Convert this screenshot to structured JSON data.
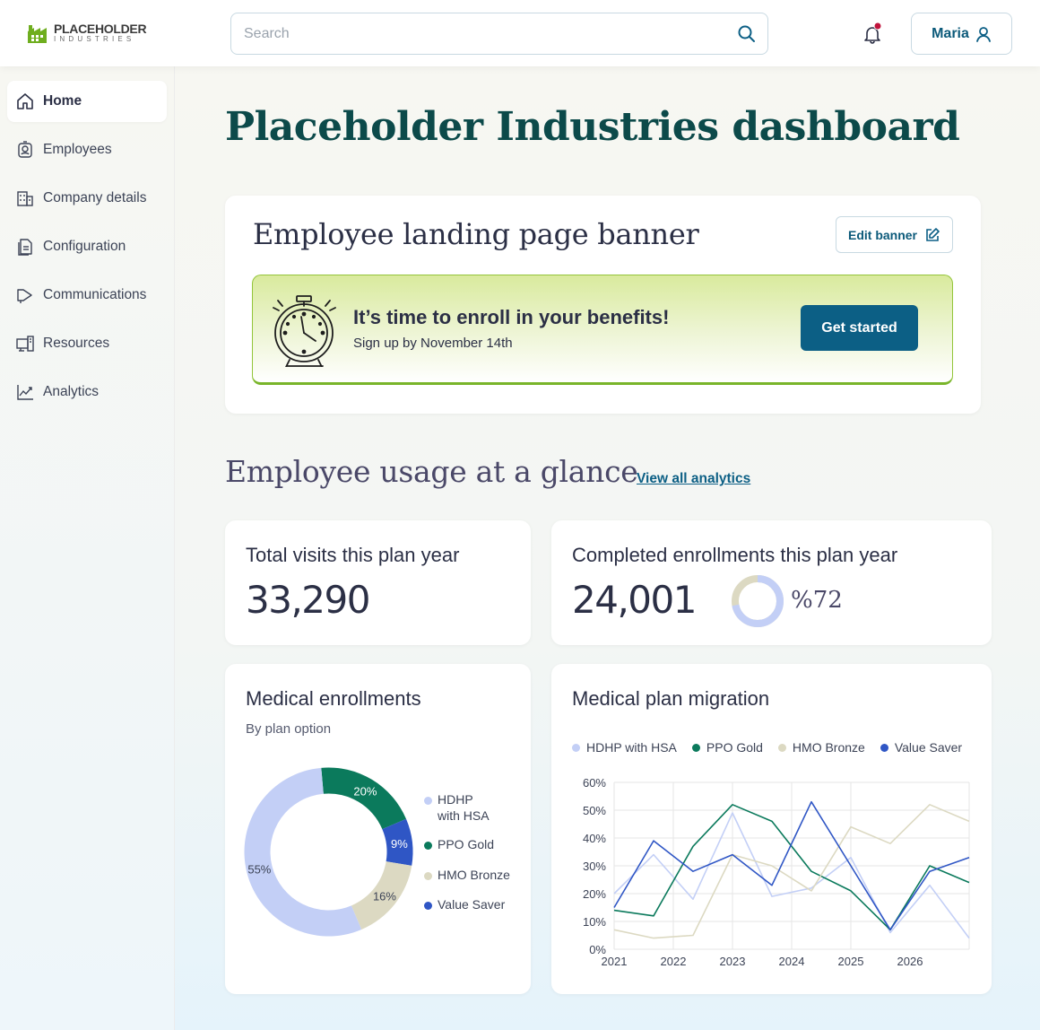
{
  "brand": {
    "name": "PLACEHOLDER",
    "sub": "INDUSTRIES"
  },
  "search": {
    "placeholder": "Search"
  },
  "user": {
    "name": "Maria"
  },
  "sidebar": {
    "items": [
      {
        "label": "Home",
        "icon": "home-icon"
      },
      {
        "label": "Employees",
        "icon": "badge-icon"
      },
      {
        "label": "Company details",
        "icon": "building-icon"
      },
      {
        "label": "Configuration",
        "icon": "document-icon"
      },
      {
        "label": "Communications",
        "icon": "megaphone-icon"
      },
      {
        "label": "Resources",
        "icon": "resources-icon"
      },
      {
        "label": "Analytics",
        "icon": "chart-line-icon"
      }
    ]
  },
  "page": {
    "title": "Placeholder Industries dashboard"
  },
  "banner": {
    "heading": "Employee landing page banner",
    "edit_label": "Edit banner",
    "promo_title": "It’s time to enroll in your benefits!",
    "promo_sub": "Sign up by November 14th",
    "cta_label": "Get started"
  },
  "usage": {
    "title": "Employee usage at a glance",
    "link": "View all analytics"
  },
  "stats": {
    "visits_label": "Total visits this plan year",
    "visits_value": "33,290",
    "enrollments_label": "Completed enrollments this plan year",
    "enrollments_value": "24,001",
    "enrollments_pct": "%72",
    "enrollments_fraction": 0.72
  },
  "colors": {
    "hdhp": "#c3cff6",
    "ppo": "#0b7a5c",
    "hmo": "#dcd9c2",
    "value": "#2f56c5",
    "accent": "#0c5f85",
    "promo_border": "#93c53a"
  },
  "chart_data": [
    {
      "type": "pie",
      "title": "Medical enrollments",
      "subtitle": "By plan option",
      "categories": [
        "HDHP with HSA",
        "PPO Gold",
        "HMO Bronze",
        "Value Saver"
      ],
      "category_lines": [
        [
          "HDHP",
          "with HSA"
        ],
        [
          "PPO Gold"
        ],
        [
          "HMO Bronze"
        ],
        [
          "Value Saver"
        ]
      ],
      "values": [
        55,
        20,
        16,
        9
      ],
      "labels": [
        "55%",
        "20%",
        "16%",
        "9%"
      ],
      "donut": true,
      "legend": "right"
    },
    {
      "type": "line",
      "title": "Medical plan migration",
      "x": [
        2021,
        2021.5,
        2022,
        2022.5,
        2023,
        2023.5,
        2024,
        2024.5,
        2025,
        2025.5,
        2026,
        2026.5,
        2027
      ],
      "xticks": [
        2021,
        2022,
        2023,
        2024,
        2025,
        2026
      ],
      "xtick_labels": [
        "2021",
        "2022",
        "2023",
        "2024",
        "2025",
        "2026"
      ],
      "ylim": [
        0,
        60
      ],
      "yticks": [
        0,
        10,
        20,
        30,
        40,
        50,
        60
      ],
      "ytick_labels": [
        "0%",
        "10%",
        "20%",
        "30%",
        "40%",
        "50%",
        "60%"
      ],
      "grid": true,
      "legend": "top",
      "series": [
        {
          "name": "HDHP with HSA",
          "values": [
            20,
            34,
            18,
            49,
            19,
            22,
            33,
            6,
            23,
            4
          ]
        },
        {
          "name": "PPO Gold",
          "values": [
            14,
            12,
            37,
            52,
            46,
            28,
            21,
            7,
            30,
            24
          ]
        },
        {
          "name": "HMO Bronze",
          "values": [
            7,
            4,
            5,
            34,
            30,
            21,
            44,
            38,
            52,
            46
          ]
        },
        {
          "name": "Value Saver",
          "values": [
            15,
            39,
            28,
            34,
            23,
            53,
            30,
            7,
            28,
            33
          ]
        }
      ]
    }
  ]
}
